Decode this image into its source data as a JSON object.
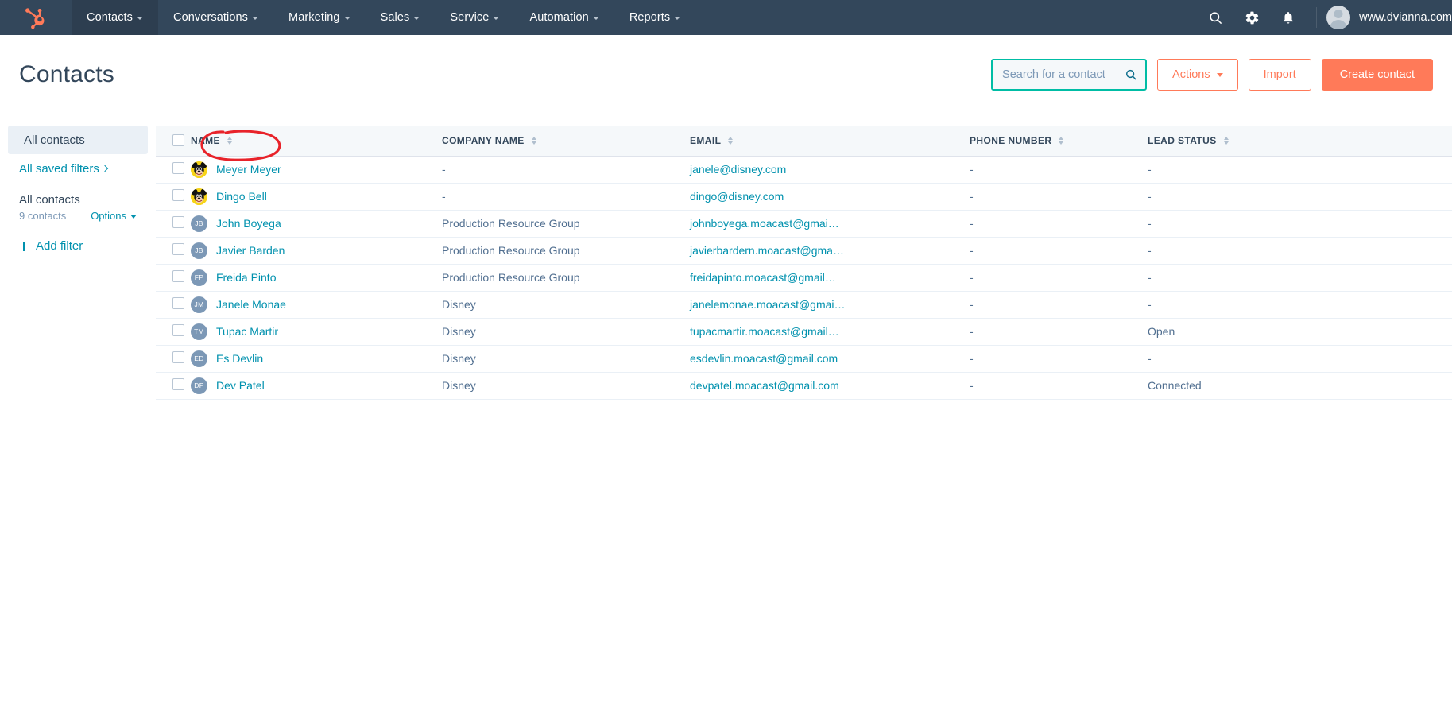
{
  "topnav": {
    "logo_icon": "hubspot-sprocket-logo",
    "items": [
      {
        "label": "Contacts",
        "has_caret": true,
        "active": true
      },
      {
        "label": "Conversations",
        "has_caret": true,
        "active": false
      },
      {
        "label": "Marketing",
        "has_caret": true,
        "active": false
      },
      {
        "label": "Sales",
        "has_caret": true,
        "active": false
      },
      {
        "label": "Service",
        "has_caret": true,
        "active": false
      },
      {
        "label": "Automation",
        "has_caret": true,
        "active": false
      },
      {
        "label": "Reports",
        "has_caret": true,
        "active": false
      }
    ],
    "icons": [
      "search-icon",
      "gear-icon",
      "bell-icon"
    ],
    "portal_name": "www.dvianna.com",
    "bg_color": "#33475b"
  },
  "header": {
    "title": "Contacts",
    "search": {
      "placeholder": "Search for a contact",
      "value": "",
      "icon": "search-icon",
      "focus_border_color": "#00bda5"
    },
    "actions_button": "Actions",
    "import_button": "Import",
    "create_button": "Create contact",
    "accent_color": "#ff7a59"
  },
  "sidebar": {
    "all_contacts_item": "All contacts",
    "saved_filters_link": "All saved filters",
    "filter_title": "All contacts",
    "filter_count": "9 contacts",
    "filter_options": "Options",
    "add_filter": "Add filter"
  },
  "table": {
    "columns": [
      {
        "label": "NAME",
        "sortable": true
      },
      {
        "label": "COMPANY NAME",
        "sortable": true
      },
      {
        "label": "EMAIL",
        "sortable": true
      },
      {
        "label": "PHONE NUMBER",
        "sortable": true
      },
      {
        "label": "LEAD STATUS",
        "sortable": true
      }
    ],
    "rows": [
      {
        "avatar_type": "image",
        "avatar": "mickey-mouse-avatar",
        "initials": "",
        "name": "Meyer Meyer",
        "company": "-",
        "email": "janele@disney.com",
        "phone": "-",
        "lead_status": "-"
      },
      {
        "avatar_type": "image",
        "avatar": "mickey-mouse-avatar",
        "initials": "",
        "name": "Dingo Bell",
        "company": "-",
        "email": "dingo@disney.com",
        "phone": "-",
        "lead_status": "-"
      },
      {
        "avatar_type": "initials",
        "avatar": "initials-avatar",
        "initials": "JB",
        "name": "John Boyega",
        "company": "Production Resource Group",
        "email": "johnboyega.moacast@gmai…",
        "phone": "-",
        "lead_status": "-"
      },
      {
        "avatar_type": "initials",
        "avatar": "initials-avatar",
        "initials": "JB",
        "name": "Javier Barden",
        "company": "Production Resource Group",
        "email": "javierbardern.moacast@gma…",
        "phone": "-",
        "lead_status": "-"
      },
      {
        "avatar_type": "initials",
        "avatar": "initials-avatar",
        "initials": "FP",
        "name": "Freida Pinto",
        "company": "Production Resource Group",
        "email": "freidapinto.moacast@gmail…",
        "phone": "-",
        "lead_status": "-"
      },
      {
        "avatar_type": "initials",
        "avatar": "initials-avatar",
        "initials": "JM",
        "name": "Janele Monae",
        "company": "Disney",
        "email": "janelemonae.moacast@gmai…",
        "phone": "-",
        "lead_status": "-"
      },
      {
        "avatar_type": "initials",
        "avatar": "initials-avatar",
        "initials": "TM",
        "name": "Tupac Martir",
        "company": "Disney",
        "email": "tupacmartir.moacast@gmail…",
        "phone": "-",
        "lead_status": "Open"
      },
      {
        "avatar_type": "initials",
        "avatar": "initials-avatar",
        "initials": "ED",
        "name": "Es Devlin",
        "company": "Disney",
        "email": "esdevlin.moacast@gmail.com",
        "phone": "-",
        "lead_status": "-"
      },
      {
        "avatar_type": "initials",
        "avatar": "initials-avatar",
        "initials": "DP",
        "name": "Dev Patel",
        "company": "Disney",
        "email": "devpatel.moacast@gmail.com",
        "phone": "-",
        "lead_status": "Connected"
      }
    ]
  },
  "annotation": {
    "shape": "hand-drawn-red-ellipse",
    "target": "Dingo Bell",
    "color": "#e8232a"
  }
}
